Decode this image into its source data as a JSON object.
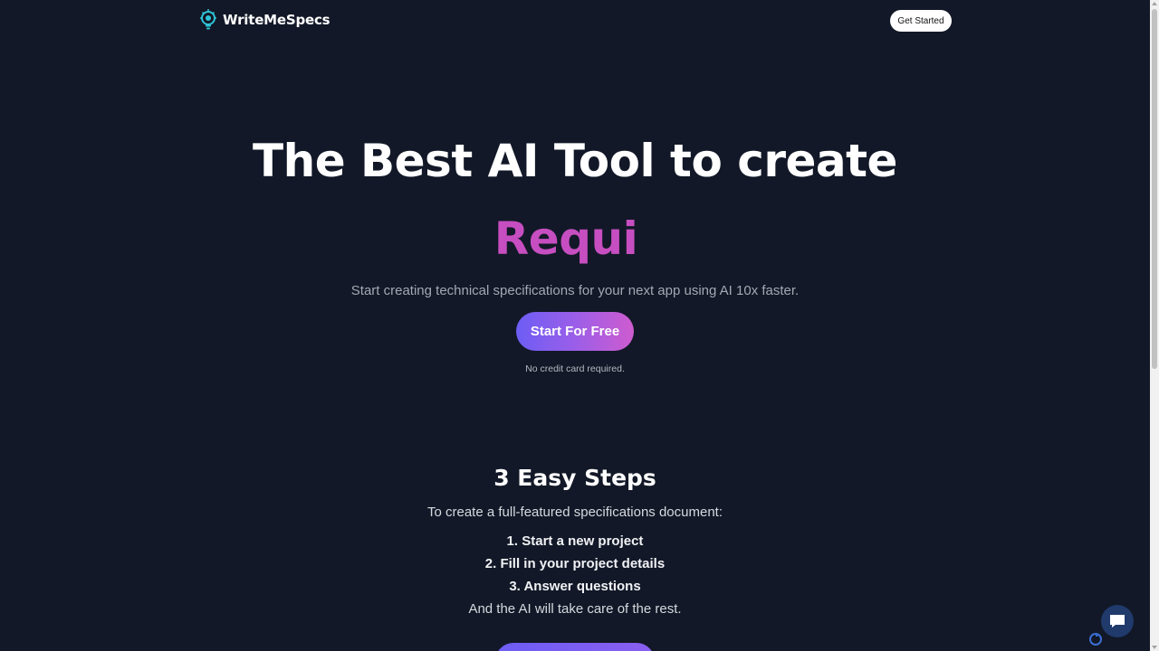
{
  "header": {
    "brand_name": "WriteMeSpecs",
    "logo_icon": "lightbulb-gear-icon",
    "get_started_label": "Get Started"
  },
  "hero": {
    "title": "The Best AI Tool to create",
    "typed_text": "Requi",
    "subtitle": "Start creating technical specifications for your next app using AI 10x faster.",
    "cta_label": "Start For Free",
    "note": "No credit card required."
  },
  "steps": {
    "title": "3 Easy Steps",
    "intro": "To create a full-featured specifications document:",
    "items": [
      "1. Start a new project",
      "2. Fill in your project details",
      "3. Answer questions"
    ],
    "outro": "And the AI will take care of the rest."
  },
  "widgets": {
    "chat_icon": "chat-bubble-icon",
    "recaptcha_icon": "recaptcha-icon"
  },
  "colors": {
    "background": "#121827",
    "accent_pink": "#c64ec0",
    "gradient_start": "#6d5df5",
    "gradient_end": "#cf5ccf"
  }
}
